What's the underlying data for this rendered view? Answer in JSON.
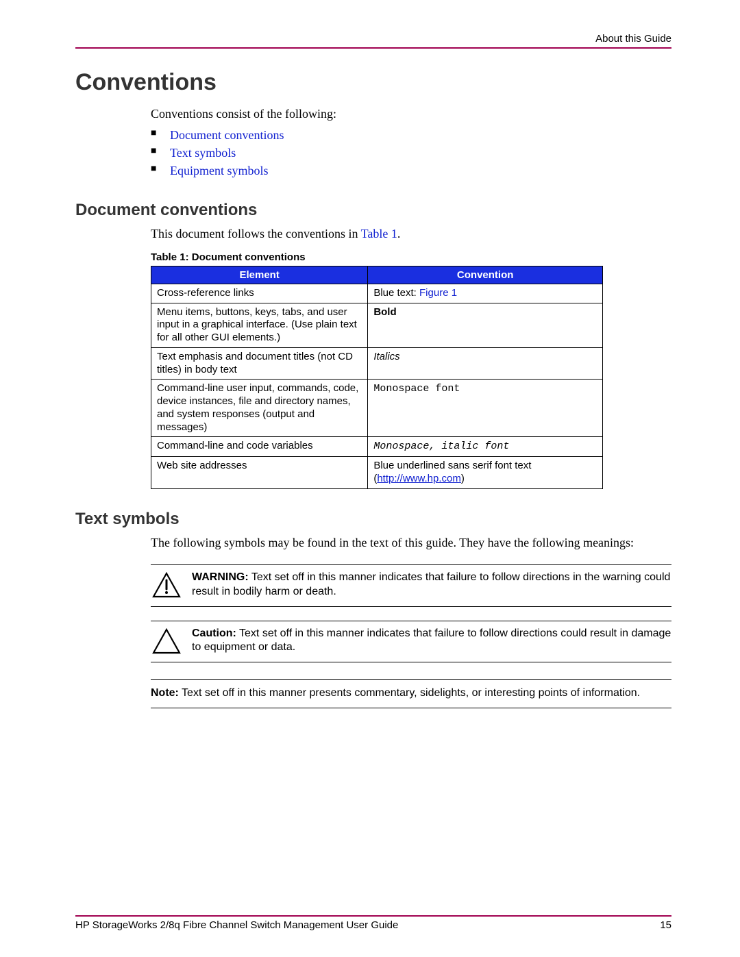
{
  "header": {
    "section": "About this Guide"
  },
  "h1": "Conventions",
  "intro": "Conventions consist of the following:",
  "bullets": [
    "Document conventions",
    "Text symbols",
    "Equipment symbols"
  ],
  "doc_conv": {
    "heading": "Document conventions",
    "text_pre": "This document follows the conventions in ",
    "text_link": "Table 1",
    "text_post": ".",
    "caption": "Table 1:  Document conventions",
    "th1": "Element",
    "th2": "Convention",
    "rows": [
      {
        "el": "Cross-reference links",
        "conv_pre": "Blue text: ",
        "conv_link": "Figure 1"
      },
      {
        "el": "Menu items, buttons, keys, tabs, and user input in a graphical interface. (Use plain text for all other GUI elements.)",
        "conv_bold": "Bold"
      },
      {
        "el": "Text emphasis and document titles (not CD titles) in body text",
        "conv_ital": "Italics"
      },
      {
        "el": "Command-line user input, commands, code, device instances, file and directory names, and system responses (output and messages)",
        "conv_mono": "Monospace font"
      },
      {
        "el": "Command-line and code variables",
        "conv_monoital": "Monospace, italic font"
      },
      {
        "el": "Web site addresses",
        "conv_pre": "Blue underlined sans serif font text (",
        "conv_linku": "http://www.hp.com",
        "conv_post": ")"
      }
    ]
  },
  "text_sym": {
    "heading": "Text symbols",
    "intro": "The following symbols may be found in the text of this guide. They have the following meanings:",
    "warning_label": "WARNING:",
    "warning_text": "  Text set off in this manner indicates that failure to follow directions in the warning could result in bodily harm or death.",
    "caution_label": "Caution:",
    "caution_text": "  Text set off in this manner indicates that failure to follow directions could result in damage to equipment or data.",
    "note_label": "Note:",
    "note_text": "  Text set off in this manner presents commentary, sidelights, or interesting points of information."
  },
  "footer": {
    "title": "HP StorageWorks 2/8q Fibre Channel Switch Management User Guide",
    "page": "15"
  }
}
